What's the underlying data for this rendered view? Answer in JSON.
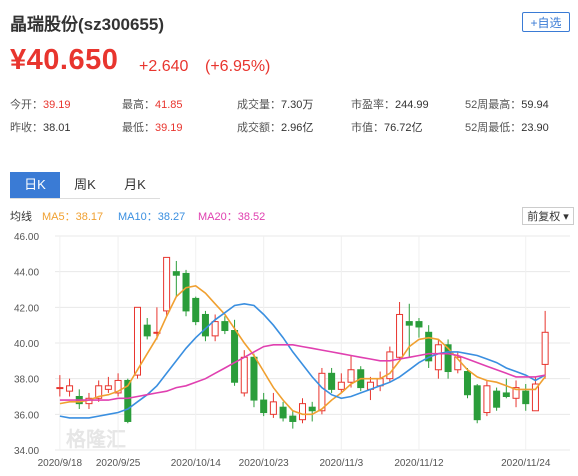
{
  "header": {
    "title": "晶瑞股份(sz300655)",
    "add_watchlist": "+自选",
    "price": "¥40.650",
    "change": "+2.640",
    "change_pct": "(+6.95%)"
  },
  "stats": [
    {
      "label": "今开：",
      "value": "39.19",
      "tone": "red"
    },
    {
      "label": "最高：",
      "value": "41.85",
      "tone": "red"
    },
    {
      "label": "成交量：",
      "value": "7.30万",
      "tone": "bold"
    },
    {
      "label": "市盈率：",
      "value": "244.99",
      "tone": "bold"
    },
    {
      "label": "52周最高：",
      "value": "59.94",
      "tone": "bold"
    },
    {
      "label": "昨收：",
      "value": "38.01",
      "tone": "bold"
    },
    {
      "label": "最低：",
      "value": "39.19",
      "tone": "red"
    },
    {
      "label": "成交额：",
      "value": "2.96亿",
      "tone": "bold"
    },
    {
      "label": "市值：",
      "value": "76.72亿",
      "tone": "bold"
    },
    {
      "label": "52周最低：",
      "value": "23.90",
      "tone": "bold"
    }
  ],
  "tabs": [
    "日K",
    "周K",
    "月K"
  ],
  "ma": {
    "label": "均线",
    "ma5": "MA5：38.17",
    "ma10": "MA10：38.27",
    "ma20": "MA20：38.52"
  },
  "adjust": "前复权 ▾",
  "colors": {
    "up": "#e8352e",
    "down": "#2a9d3a",
    "accent": "#3a7bd5",
    "ma5": "#f0a030",
    "ma10": "#3a8fe0",
    "ma20": "#e040b0"
  },
  "chart_data": {
    "type": "candlestick",
    "ylim": [
      34,
      46
    ],
    "yticks": [
      "34.00",
      "36.00",
      "38.00",
      "40.00",
      "42.00",
      "44.00",
      "46.00"
    ],
    "x_labels": [
      "2020/9/18",
      "2020/9/25",
      "2020/10/14",
      "2020/10/23",
      "2020/11/3",
      "2020/11/12",
      "2020/11/24"
    ],
    "watermark": "格隆汇",
    "candles": [
      {
        "o": 37.5,
        "c": 37.5,
        "h": 38.2,
        "l": 37.0
      },
      {
        "o": 37.3,
        "c": 37.6,
        "h": 38.0,
        "l": 37.0
      },
      {
        "o": 37.0,
        "c": 36.6,
        "h": 37.4,
        "l": 36.3
      },
      {
        "o": 36.6,
        "c": 36.9,
        "h": 37.2,
        "l": 36.3
      },
      {
        "o": 36.9,
        "c": 37.6,
        "h": 37.9,
        "l": 36.7
      },
      {
        "o": 37.4,
        "c": 37.6,
        "h": 38.1,
        "l": 37.2
      },
      {
        "o": 37.2,
        "c": 37.9,
        "h": 38.3,
        "l": 37.0
      },
      {
        "o": 37.9,
        "c": 35.6,
        "h": 38.0,
        "l": 35.5
      },
      {
        "o": 38.2,
        "c": 42.0,
        "h": 42.0,
        "l": 38.0
      },
      {
        "o": 41.0,
        "c": 40.4,
        "h": 41.4,
        "l": 40.2
      },
      {
        "o": 40.6,
        "c": 40.6,
        "h": 42.0,
        "l": 40.2
      },
      {
        "o": 41.8,
        "c": 44.8,
        "h": 44.8,
        "l": 41.5
      },
      {
        "o": 44.0,
        "c": 43.8,
        "h": 44.6,
        "l": 42.6
      },
      {
        "o": 43.9,
        "c": 41.8,
        "h": 44.1,
        "l": 41.5
      },
      {
        "o": 42.5,
        "c": 41.2,
        "h": 42.6,
        "l": 41.0
      },
      {
        "o": 41.6,
        "c": 40.4,
        "h": 41.8,
        "l": 40.1
      },
      {
        "o": 40.4,
        "c": 41.2,
        "h": 41.6,
        "l": 40.1
      },
      {
        "o": 41.2,
        "c": 40.7,
        "h": 41.5,
        "l": 40.5
      },
      {
        "o": 40.7,
        "c": 37.8,
        "h": 41.3,
        "l": 37.6
      },
      {
        "o": 37.2,
        "c": 39.2,
        "h": 39.6,
        "l": 37.0
      },
      {
        "o": 39.2,
        "c": 36.8,
        "h": 39.4,
        "l": 36.4
      },
      {
        "o": 36.8,
        "c": 36.1,
        "h": 37.2,
        "l": 35.9
      },
      {
        "o": 36.0,
        "c": 36.7,
        "h": 37.2,
        "l": 35.8
      },
      {
        "o": 36.4,
        "c": 35.8,
        "h": 36.7,
        "l": 35.6
      },
      {
        "o": 35.9,
        "c": 35.6,
        "h": 36.2,
        "l": 35.2
      },
      {
        "o": 35.7,
        "c": 36.6,
        "h": 36.9,
        "l": 35.5
      },
      {
        "o": 36.4,
        "c": 36.2,
        "h": 36.7,
        "l": 35.6
      },
      {
        "o": 36.2,
        "c": 38.3,
        "h": 38.6,
        "l": 36.0
      },
      {
        "o": 38.3,
        "c": 37.4,
        "h": 38.6,
        "l": 37.2
      },
      {
        "o": 37.4,
        "c": 37.8,
        "h": 38.3,
        "l": 37.2
      },
      {
        "o": 37.8,
        "c": 38.5,
        "h": 39.3,
        "l": 37.5
      },
      {
        "o": 38.5,
        "c": 37.5,
        "h": 38.7,
        "l": 37.3
      },
      {
        "o": 37.4,
        "c": 37.8,
        "h": 38.1,
        "l": 36.8
      },
      {
        "o": 37.6,
        "c": 38.0,
        "h": 38.4,
        "l": 37.3
      },
      {
        "o": 38.0,
        "c": 39.5,
        "h": 39.8,
        "l": 37.8
      },
      {
        "o": 39.2,
        "c": 41.6,
        "h": 42.3,
        "l": 39.0
      },
      {
        "o": 41.2,
        "c": 41.0,
        "h": 42.2,
        "l": 39.2
      },
      {
        "o": 41.2,
        "c": 40.9,
        "h": 41.4,
        "l": 40.3
      },
      {
        "o": 40.6,
        "c": 39.0,
        "h": 41.0,
        "l": 38.6
      },
      {
        "o": 38.5,
        "c": 39.9,
        "h": 40.2,
        "l": 38.0
      },
      {
        "o": 39.9,
        "c": 38.4,
        "h": 40.2,
        "l": 38.0
      },
      {
        "o": 38.5,
        "c": 39.2,
        "h": 39.5,
        "l": 38.3
      },
      {
        "o": 38.4,
        "c": 37.1,
        "h": 38.6,
        "l": 36.9
      },
      {
        "o": 37.6,
        "c": 35.7,
        "h": 37.7,
        "l": 35.5
      },
      {
        "o": 36.1,
        "c": 37.6,
        "h": 37.9,
        "l": 35.9
      },
      {
        "o": 37.3,
        "c": 36.4,
        "h": 37.5,
        "l": 36.2
      },
      {
        "o": 37.2,
        "c": 37.0,
        "h": 38.0,
        "l": 36.9
      },
      {
        "o": 36.9,
        "c": 37.5,
        "h": 37.9,
        "l": 36.4
      },
      {
        "o": 37.3,
        "c": 36.6,
        "h": 37.7,
        "l": 36.2
      },
      {
        "o": 36.2,
        "c": 37.7,
        "h": 38.1,
        "l": 36.2
      },
      {
        "o": 38.8,
        "c": 40.6,
        "h": 41.8,
        "l": 38.0
      }
    ],
    "series": [
      {
        "name": "MA5",
        "values": [
          36.6,
          36.7,
          36.7,
          36.8,
          37.0,
          37.1,
          37.3,
          37.6,
          38.5,
          39.4,
          40.3,
          41.5,
          42.6,
          43.1,
          43.2,
          42.8,
          42.2,
          41.6,
          40.8,
          40.0,
          39.3,
          38.4,
          37.5,
          36.8,
          36.2,
          36.0,
          36.0,
          36.3,
          36.8,
          37.2,
          37.7,
          38.0,
          38.0,
          38.0,
          38.3,
          39.0,
          39.8,
          40.2,
          40.3,
          40.2,
          39.7,
          39.1,
          38.5,
          38.1,
          37.9,
          37.8,
          37.6,
          37.4,
          37.4,
          37.4,
          38.1
        ]
      },
      {
        "name": "MA10",
        "values": [
          35.9,
          35.8,
          35.8,
          35.8,
          35.9,
          36.0,
          36.1,
          36.3,
          36.7,
          37.1,
          37.6,
          38.3,
          39.0,
          39.7,
          40.3,
          40.8,
          41.3,
          41.7,
          42.1,
          42.2,
          42.1,
          41.6,
          41.0,
          40.3,
          39.5,
          38.8,
          38.1,
          37.5,
          37.1,
          36.9,
          37.0,
          37.2,
          37.4,
          37.6,
          37.8,
          38.1,
          38.5,
          38.9,
          39.2,
          39.4,
          39.5,
          39.5,
          39.4,
          39.3,
          39.1,
          38.9,
          38.6,
          38.4,
          38.2,
          37.9,
          38.2
        ]
      },
      {
        "name": "MA20",
        "values": [
          36.8,
          36.8,
          36.8,
          36.8,
          36.8,
          36.8,
          36.9,
          36.9,
          37.0,
          37.1,
          37.2,
          37.3,
          37.5,
          37.6,
          37.8,
          38.0,
          38.3,
          38.6,
          38.9,
          39.2,
          39.5,
          39.8,
          39.9,
          39.9,
          39.9,
          39.8,
          39.7,
          39.6,
          39.5,
          39.4,
          39.3,
          39.2,
          39.1,
          39.0,
          39.0,
          39.1,
          39.2,
          39.3,
          39.4,
          39.4,
          39.4,
          39.3,
          39.1,
          38.9,
          38.7,
          38.5,
          38.3,
          38.1,
          38.1,
          38.1,
          38.2
        ]
      }
    ]
  }
}
